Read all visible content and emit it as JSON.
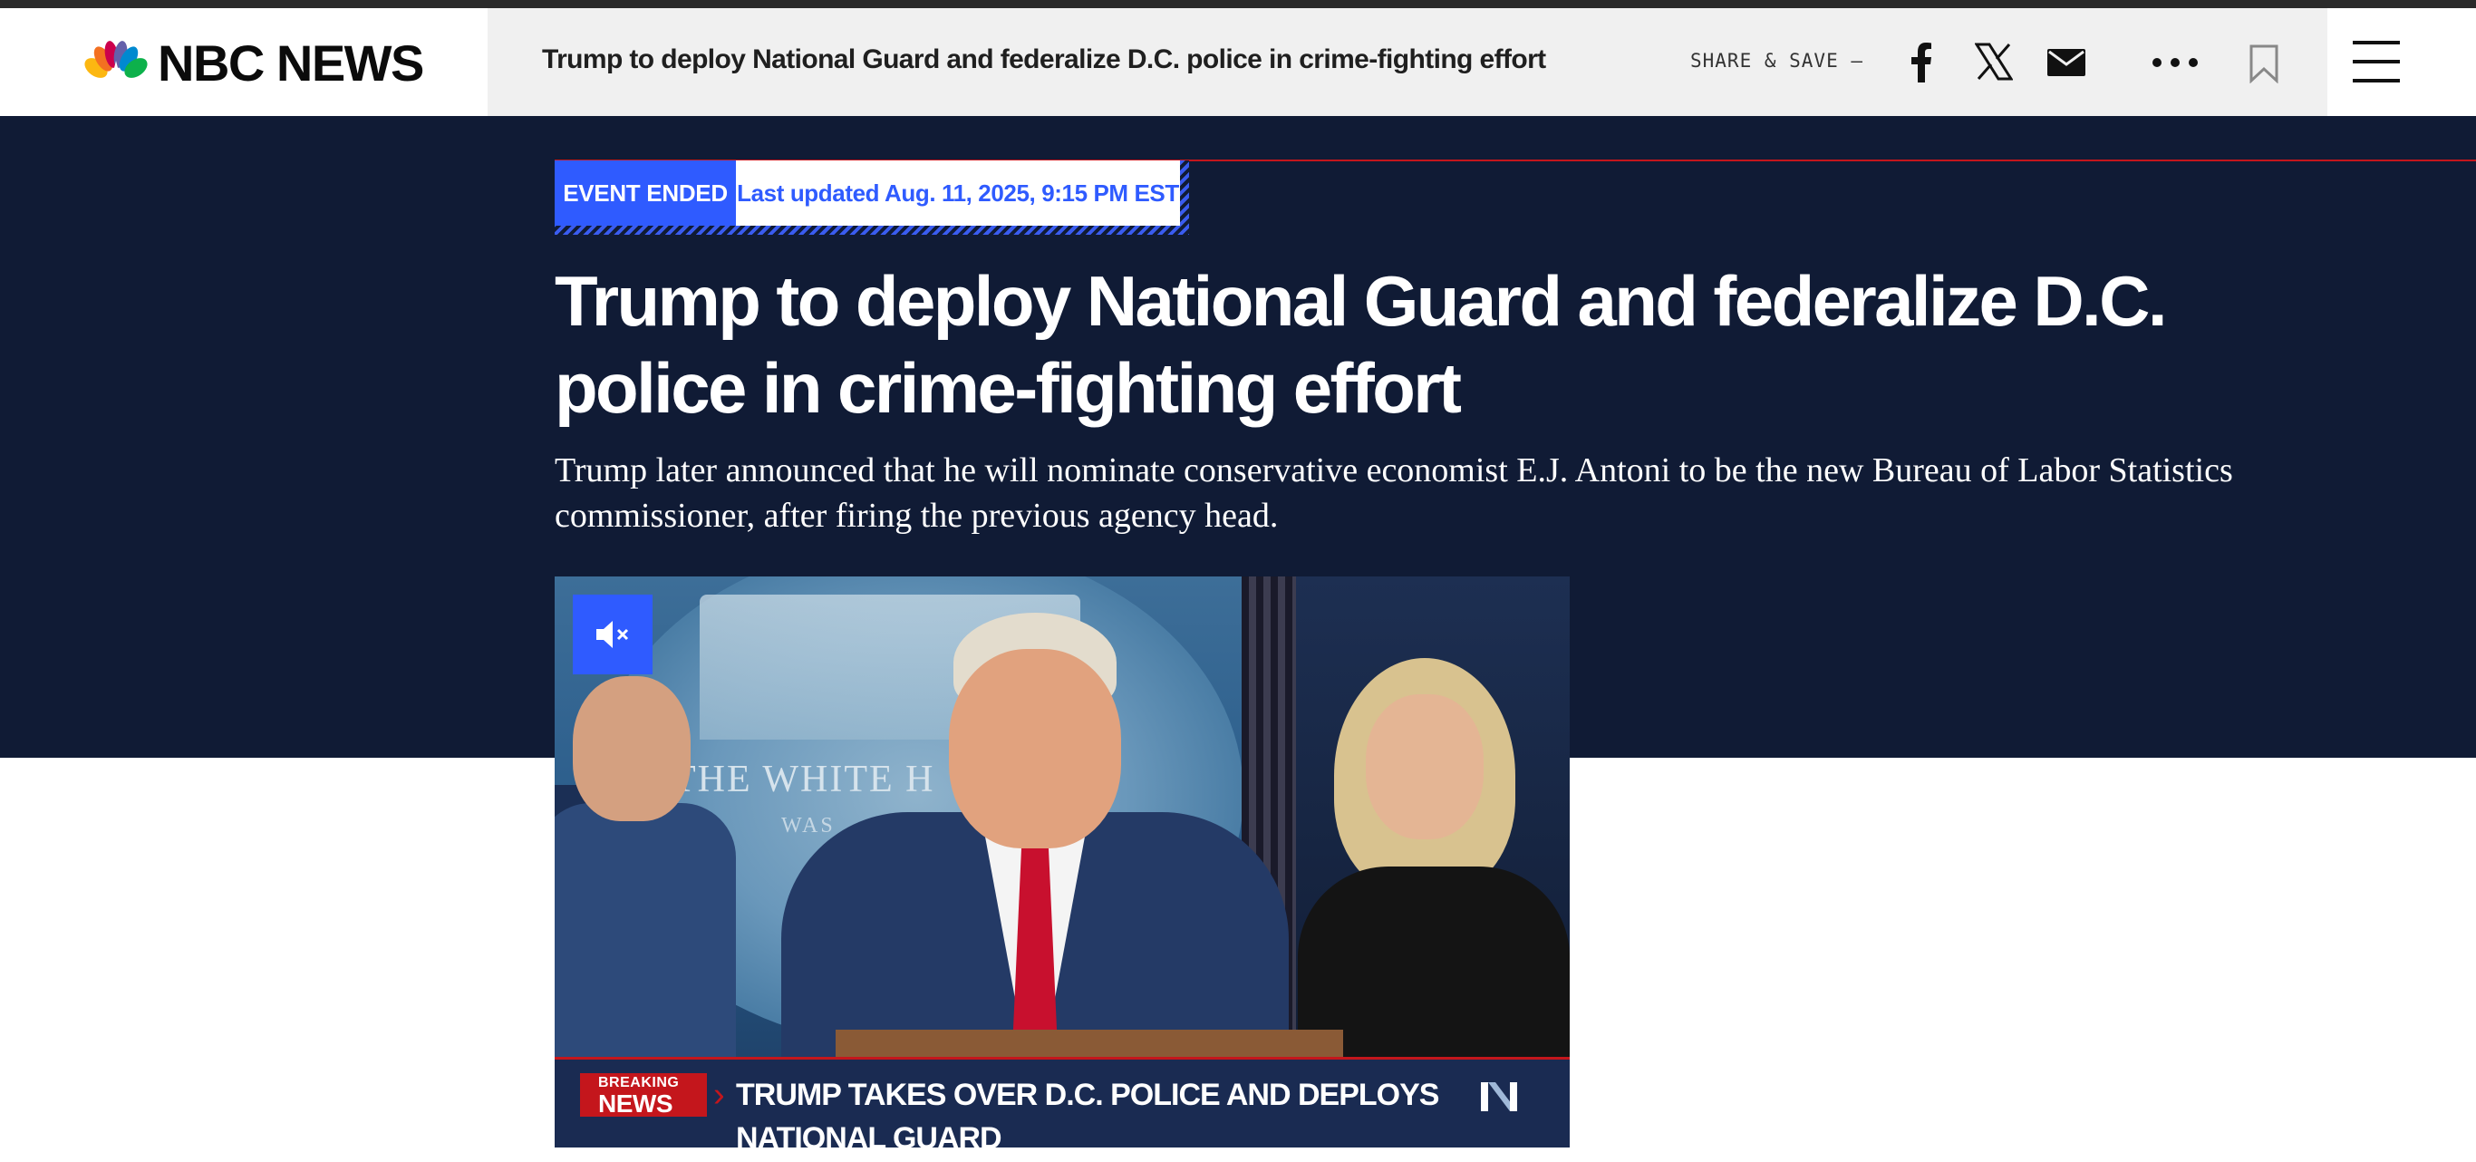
{
  "brand": {
    "name": "NBC NEWS"
  },
  "header": {
    "title": "Trump to deploy National Guard and federalize D.C. police in crime-fighting effort",
    "share_label": "SHARE & SAVE —"
  },
  "event": {
    "status": "EVENT ENDED",
    "updated": "Last updated Aug. 11, 2025, 9:15 PM EST"
  },
  "article": {
    "headline": "Trump to deploy National Guard and federalize D.C. police in crime-fighting effort",
    "dek": "Trump later announced that he will nominate conservative economist E.J. Antoni to be the new Bureau of Labor Statistics commissioner, after firing the previous agency head."
  },
  "video": {
    "seal_text": "THE WHITE H",
    "seal_subtext": "WAS",
    "breaking_top": "BREAKING",
    "breaking_bottom": "NEWS",
    "ticker": "TRUMP TAKES OVER D.C. POLICE AND DEPLOYS NATIONAL GUARD"
  },
  "icons": [
    "nbc-peacock-icon",
    "facebook-icon",
    "x-icon",
    "email-icon",
    "more-icon",
    "bookmark-icon",
    "menu-icon",
    "mute-icon"
  ],
  "colors": {
    "hero_bg": "#101b35",
    "accent_blue": "#2f5bff",
    "accent_red": "#c4161c"
  }
}
